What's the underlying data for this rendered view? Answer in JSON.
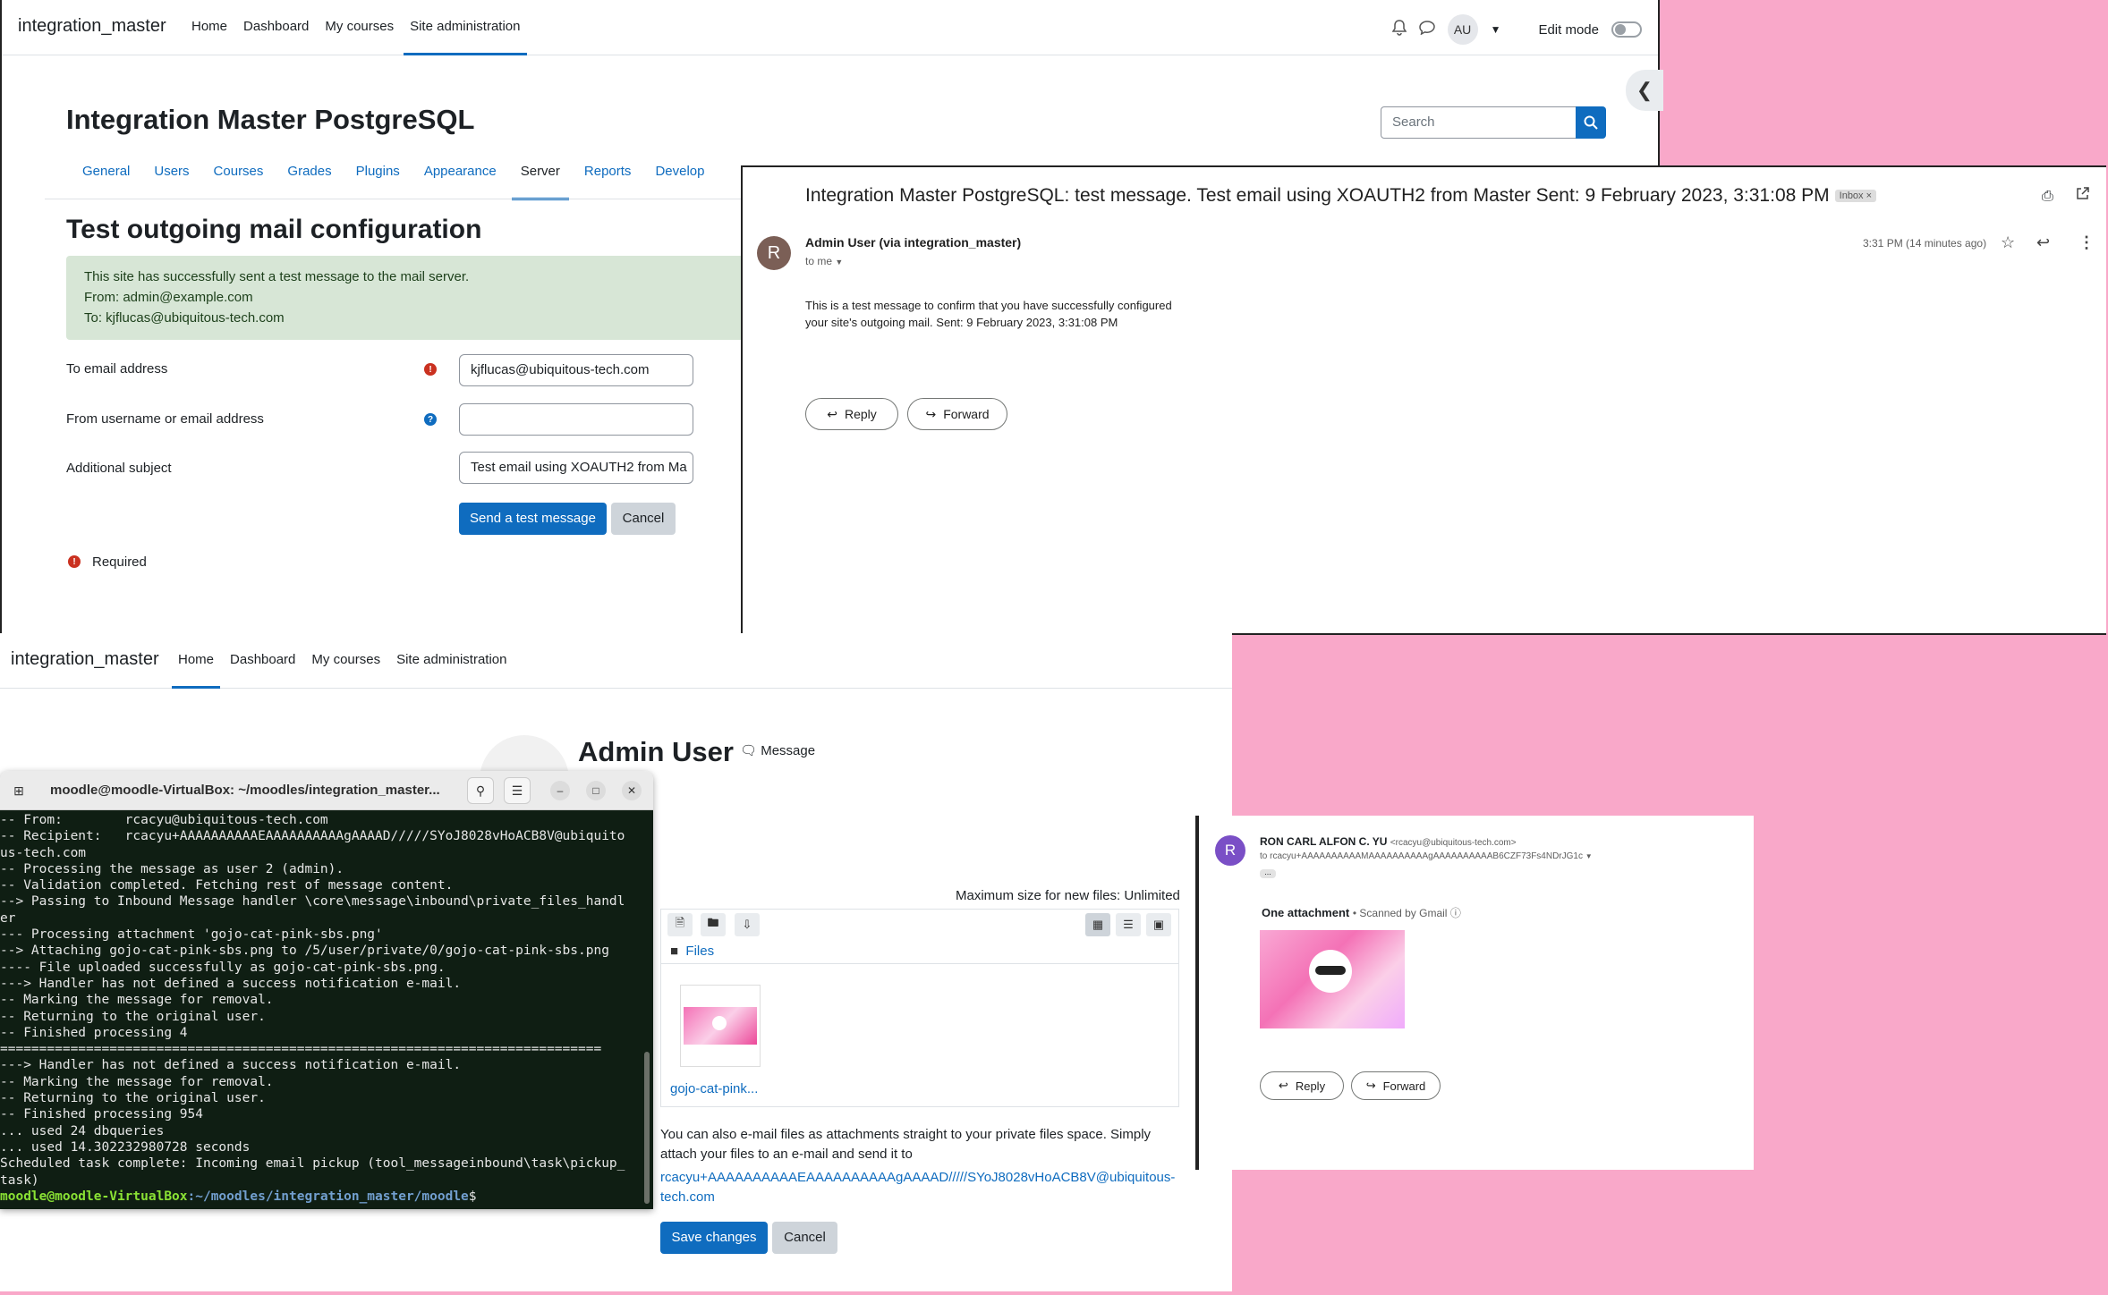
{
  "top_moodle": {
    "brand": "integration_master",
    "nav": [
      "Home",
      "Dashboard",
      "My courses",
      "Site administration"
    ],
    "nav_active": "Site administration",
    "avatar_initials": "AU",
    "edit_mode_label": "Edit mode",
    "page_title": "Integration Master PostgreSQL",
    "search_placeholder": "Search",
    "section_tabs": [
      "General",
      "Users",
      "Courses",
      "Grades",
      "Plugins",
      "Appearance",
      "Server",
      "Reports",
      "Develop"
    ],
    "section_active": "Server",
    "heading": "Test outgoing mail configuration",
    "alert": {
      "line1": "This site has successfully sent a test message to the mail server.",
      "line2": "From: admin@example.com",
      "line3": "To: kjflucas@ubiquitous-tech.com"
    },
    "form": {
      "to_label": "To email address",
      "to_value": "kjflucas@ubiquitous-tech.com",
      "from_label": "From username or email address",
      "from_value": "",
      "subject_label": "Additional subject",
      "subject_value": "Test email using XOAUTH2 from Ma",
      "send_button": "Send a test message",
      "cancel_button": "Cancel",
      "required_label": "Required"
    }
  },
  "gmail_top": {
    "subject": "Integration Master PostgreSQL: test message. Test email using XOAUTH2 from Master Sent: 9 February 2023, 3:31:08 PM",
    "inbox_tag": "Inbox ×",
    "sender_initial": "R",
    "sender": "Admin User (via integration_master)",
    "to": "to me",
    "time": "3:31 PM (14 minutes ago)",
    "body_line1": "This is a test message to confirm that you have successfully configured",
    "body_line2": "your site's outgoing mail. Sent: 9 February 2023, 3:31:08 PM",
    "reply": "Reply",
    "forward": "Forward",
    "avatar_color": "#7b5f56"
  },
  "bottom_moodle": {
    "brand": "integration_master",
    "nav": [
      "Home",
      "Dashboard",
      "My courses",
      "Site administration"
    ],
    "nav_active": "Home",
    "profile_name": "Admin User",
    "message_link": "Message",
    "max_size": "Maximum size for new files: Unlimited",
    "files_breadcrumb": "Files",
    "file_name": "gojo-cat-pink...",
    "info_line1": "You can also e-mail files as attachments straight to your private files space. Simply",
    "info_line2": "attach your files to an e-mail and send it to",
    "email_link1": "rcacyu+AAAAAAAAAAEAAAAAAAAAAgAAAAD/////SYoJ8028vHoACB8V@ubiquitous-",
    "email_link2": "tech.com",
    "save_button": "Save changes",
    "cancel_button": "Cancel"
  },
  "terminal": {
    "title": "moodle@moodle-VirtualBox: ~/moodles/integration_master...",
    "lines": [
      "-- From:        rcacyu@ubiquitous-tech.com",
      "-- Recipient:   rcacyu+AAAAAAAAAAEAAAAAAAAAAgAAAAD/////SYoJ8028vHoACB8V@ubiquito",
      "us-tech.com",
      "-- Processing the message as user 2 (admin).",
      "-- Validation completed. Fetching rest of message content.",
      "--> Passing to Inbound Message handler \\core\\message\\inbound\\private_files_handl",
      "er",
      "--- Processing attachment 'gojo-cat-pink-sbs.png'",
      "--> Attaching gojo-cat-pink-sbs.png to /5/user/private/0/gojo-cat-pink-sbs.png",
      "---- File uploaded successfully as gojo-cat-pink-sbs.png.",
      "---> Handler has not defined a success notification e-mail.",
      "-- Marking the message for removal.",
      "-- Returning to the original user.",
      "-- Finished processing 4",
      "=============================================================================",
      "---> Handler has not defined a success notification e-mail.",
      "-- Marking the message for removal.",
      "-- Returning to the original user.",
      "-- Finished processing 954",
      "... used 24 dbqueries",
      "... used 14.302232980728 seconds",
      "Scheduled task complete: Incoming email pickup (tool_messageinbound\\task\\pickup_",
      "task)"
    ],
    "prompt_user": "moodle@moodle-VirtualBox",
    "prompt_path": ":~/moodles/integration_master/moodle",
    "prompt_end": "$"
  },
  "gmail_bottom": {
    "sender_initial": "R",
    "sender": "RON CARL ALFON C. YU",
    "sender_email": "<rcacyu@ubiquitous-tech.com>",
    "to": "to rcacyu+AAAAAAAAAAMAAAAAAAAAAgAAAAAAAAAAB6CZF73Fs4NDrJG1c",
    "attachment_label": "One attachment",
    "scanned": "Scanned by Gmail",
    "reply": "Reply",
    "forward": "Forward",
    "avatar_color": "#7a4fc6"
  }
}
